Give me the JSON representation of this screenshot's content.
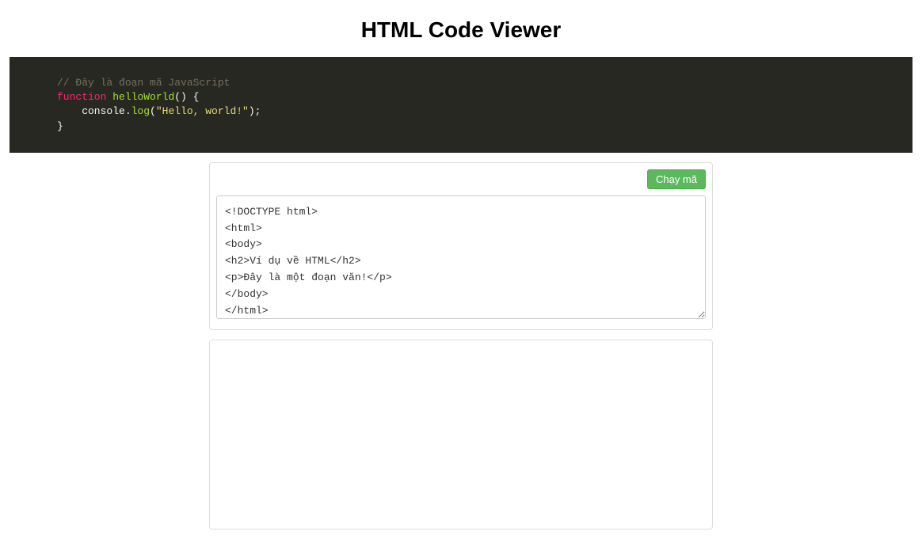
{
  "header": {
    "title": "HTML Code Viewer"
  },
  "syntax_block": {
    "line1_comment": "// Đây là đoạn mã JavaScript",
    "line2_keyword": "function",
    "line2_funcname": "helloWorld",
    "line2_rest": "() {",
    "line3_indent": "    console.",
    "line3_log": "log",
    "line3_paren_open": "(",
    "line3_string": "\"Hello, world!\"",
    "line3_paren_close": ");",
    "line4_close": "}"
  },
  "editor": {
    "run_button_label": "Chạy mã",
    "textarea_value": "<!DOCTYPE html>\n<html>\n<body>\n<h2>Ví dụ về HTML</h2>\n<p>Đây là một đoạn văn!</p>\n</body>\n</html>"
  },
  "output": {
    "content": ""
  }
}
